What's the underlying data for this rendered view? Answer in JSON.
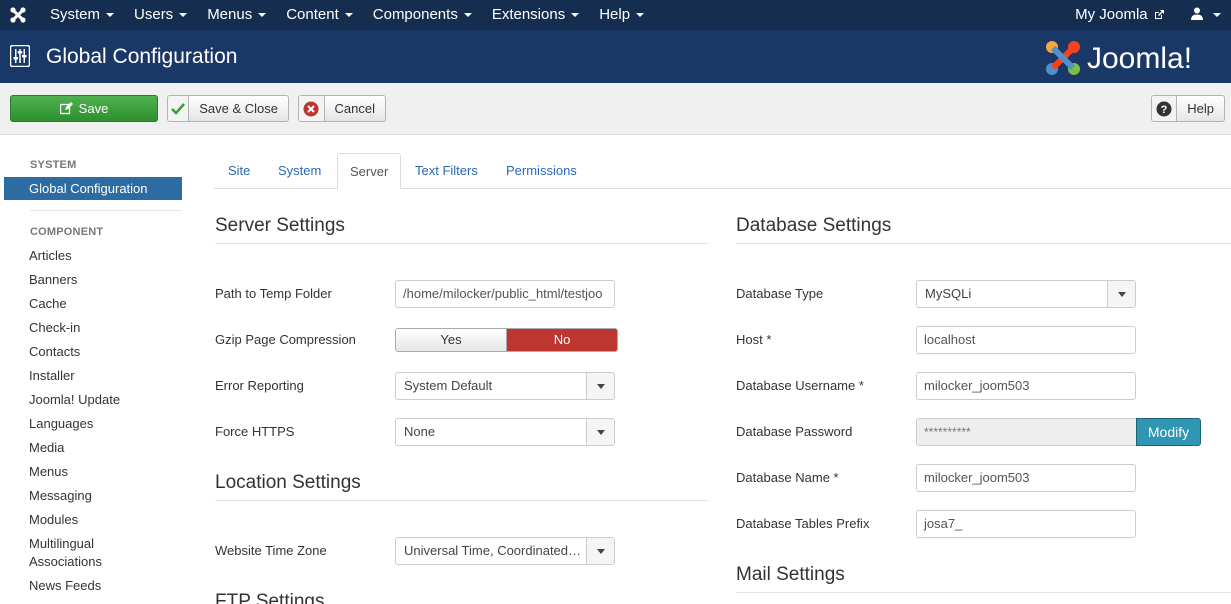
{
  "navbar": {
    "menu": [
      "System",
      "Users",
      "Menus",
      "Content",
      "Components",
      "Extensions",
      "Help"
    ],
    "my_joomla": "My Joomla"
  },
  "header": {
    "title": "Global Configuration",
    "brand": "Joomla!"
  },
  "toolbar": {
    "save": "Save",
    "save_close": "Save & Close",
    "cancel": "Cancel",
    "help": "Help"
  },
  "sidebar": {
    "system_heading": "SYSTEM",
    "active_item": "Global Configuration",
    "component_heading": "COMPONENT",
    "items": [
      "Articles",
      "Banners",
      "Cache",
      "Check-in",
      "Contacts",
      "Installer",
      "Joomla! Update",
      "Languages",
      "Media",
      "Menus",
      "Messaging",
      "Modules",
      "Multilingual",
      "Associations",
      "News Feeds"
    ]
  },
  "tabs": [
    "Site",
    "System",
    "Server",
    "Text Filters",
    "Permissions"
  ],
  "active_tab": "Server",
  "server": {
    "title": "Server Settings",
    "temp_label": "Path to Temp Folder",
    "temp_value": "/home/milocker/public_html/testjoo",
    "gzip_label": "Gzip Page Compression",
    "gzip_yes": "Yes",
    "gzip_no": "No",
    "error_label": "Error Reporting",
    "error_value": "System Default",
    "https_label": "Force HTTPS",
    "https_value": "None"
  },
  "location": {
    "title": "Location Settings",
    "tz_label": "Website Time Zone",
    "tz_value": "Universal Time, Coordinated (UTC)"
  },
  "ftp": {
    "title": "FTP Settings"
  },
  "database": {
    "title": "Database Settings",
    "type_label": "Database Type",
    "type_value": "MySQLi",
    "host_label": "Host *",
    "host_value": "localhost",
    "user_label": "Database Username *",
    "user_value": "milocker_joom503",
    "pwd_label": "Database Password",
    "pwd_value": "**********",
    "modify": "Modify",
    "name_label": "Database Name *",
    "name_value": "milocker_joom503",
    "prefix_label": "Database Tables Prefix",
    "prefix_value": "josa7_"
  },
  "mail": {
    "title": "Mail Settings"
  },
  "colors": {
    "navbar": "#152e4f",
    "header": "#1a3867",
    "save": "#3a9d3a",
    "active": "#2d6ca2",
    "no": "#bd362f",
    "modify": "#2f96b4"
  }
}
